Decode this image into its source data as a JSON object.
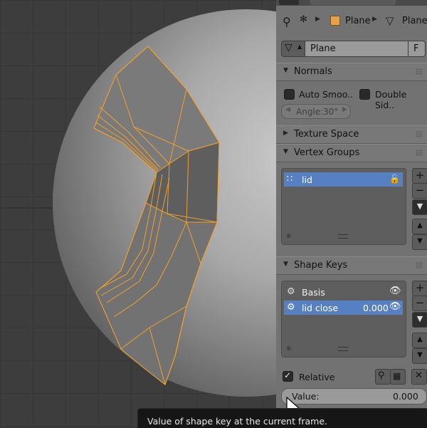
{
  "breadcrumb": {
    "object": "Plane",
    "mesh": "Plane"
  },
  "datablock": {
    "name": "Plane",
    "fake_user": "F"
  },
  "normals": {
    "header": "Normals",
    "auto_smooth": "Auto Smoo..",
    "double_sided": "Double Sid..",
    "angle": "Angle:",
    "angle_value": "30°"
  },
  "texture_space": {
    "header": "Texture Space"
  },
  "vertex_groups": {
    "header": "Vertex Groups",
    "items": [
      {
        "name": "lid"
      }
    ]
  },
  "shape_keys": {
    "header": "Shape Keys",
    "items": [
      {
        "name": "Basis",
        "value": ""
      },
      {
        "name": "lid close",
        "value": "0.000"
      }
    ],
    "relative": "Relative",
    "value_label": "Value:",
    "value": "0.000"
  },
  "tooltip": {
    "text": "Value of shape key at the current frame."
  },
  "colors": {
    "accent": "#5680c2",
    "selection_wire": "#f2a02a",
    "panel_bg": "#727272"
  },
  "icons": [
    "pin-icon",
    "scene-icon",
    "object-cube-icon",
    "mesh-icon",
    "eye-icon",
    "lock-icon",
    "plus-icon",
    "minus-icon"
  ]
}
